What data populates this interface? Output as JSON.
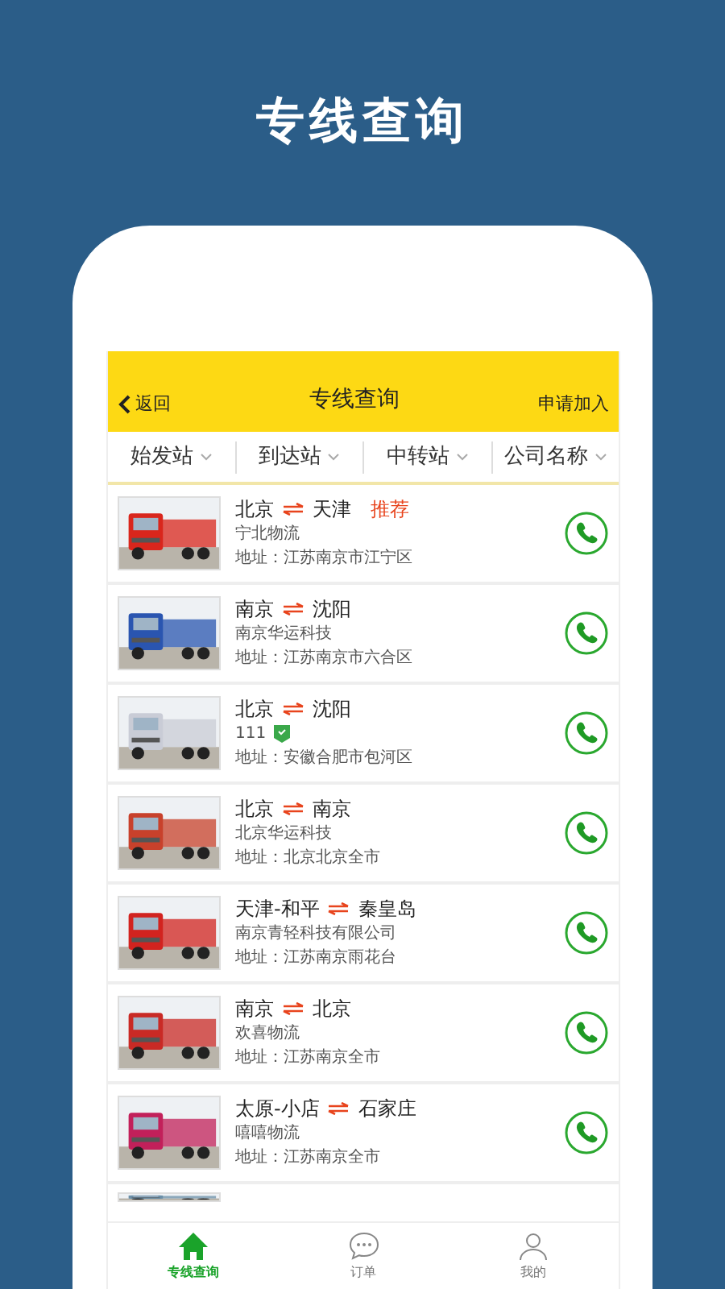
{
  "page_title": "专线查询",
  "header": {
    "back": "返回",
    "title": "专线查询",
    "action": "申请加入"
  },
  "filters": [
    "始发站",
    "到达站",
    "中转站",
    "公司名称"
  ],
  "routes": [
    {
      "from": "北京",
      "to": "天津",
      "tag": "推荐",
      "company": "宁北物流",
      "address": "地址：江苏南京市江宁区",
      "verified": false
    },
    {
      "from": "南京",
      "to": "沈阳",
      "company": "南京华运科技",
      "address": "地址：江苏南京市六合区",
      "verified": false
    },
    {
      "from": "北京",
      "to": "沈阳",
      "company": "111",
      "address": "地址：安徽合肥市包河区",
      "verified": true
    },
    {
      "from": "北京",
      "to": "南京",
      "company": "北京华运科技",
      "address": "地址：北京北京全市",
      "verified": false
    },
    {
      "from": "天津-和平",
      "to": "秦皇岛",
      "company": "南京青轻科技有限公司",
      "address": "地址：江苏南京雨花台",
      "verified": false
    },
    {
      "from": "南京",
      "to": "北京",
      "company": "欢喜物流",
      "address": "地址：江苏南京全市",
      "verified": false
    },
    {
      "from": "太原-小店",
      "to": "石家庄",
      "company": "嘻嘻物流",
      "address": "地址：江苏南京全市",
      "verified": false
    }
  ],
  "tabs": [
    {
      "label": "专线查询",
      "kind": "home",
      "selected": true
    },
    {
      "label": "订单",
      "kind": "chat",
      "selected": false
    },
    {
      "label": "我的",
      "kind": "person",
      "selected": false
    }
  ]
}
